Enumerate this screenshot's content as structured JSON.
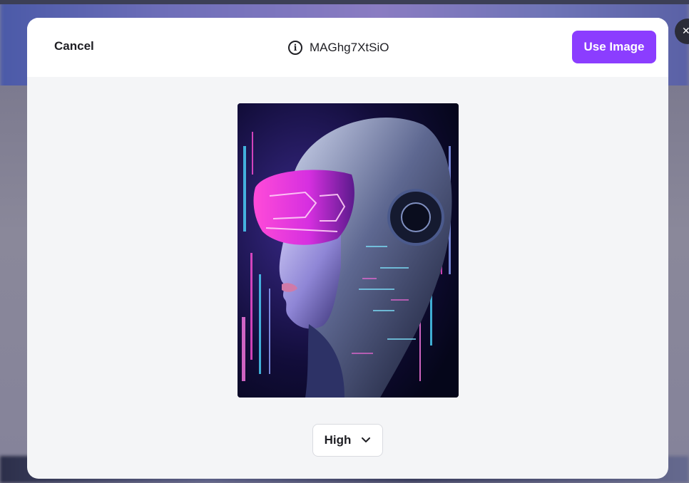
{
  "modal": {
    "cancel_label": "Cancel",
    "image_id": "MAGhg7XtSiO",
    "use_image_label": "Use Image"
  },
  "quality_select": {
    "selected": "High"
  },
  "preview": {
    "alt": "Futuristic cyborg woman with glowing magenta visor"
  },
  "colors": {
    "accent": "#8b3dff",
    "modal_bg": "#f4f5f7",
    "header_bg": "#ffffff",
    "text": "#1f1f24"
  },
  "icons": {
    "info": "info-icon",
    "chevron": "chevron-down-icon",
    "close": "close-icon"
  }
}
